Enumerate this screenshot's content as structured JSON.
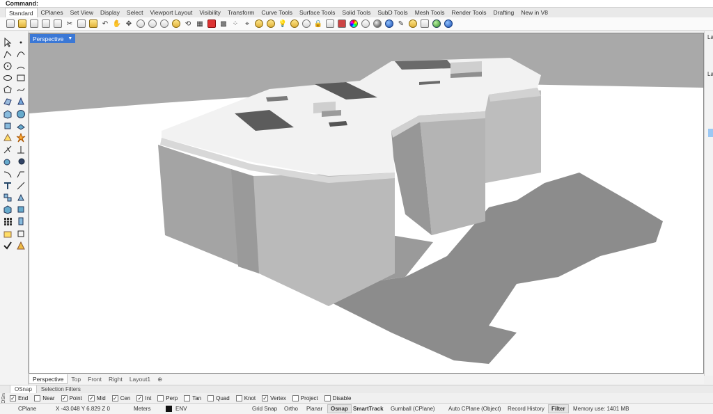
{
  "command": {
    "label": "Command:"
  },
  "tabs": [
    {
      "label": "Standard"
    },
    {
      "label": "CPlanes"
    },
    {
      "label": "Set View"
    },
    {
      "label": "Display"
    },
    {
      "label": "Select"
    },
    {
      "label": "Viewport Layout"
    },
    {
      "label": "Visibility"
    },
    {
      "label": "Transform"
    },
    {
      "label": "Curve Tools"
    },
    {
      "label": "Surface Tools"
    },
    {
      "label": "Solid Tools"
    },
    {
      "label": "SubD Tools"
    },
    {
      "label": "Mesh Tools"
    },
    {
      "label": "Render Tools"
    },
    {
      "label": "Drafting"
    },
    {
      "label": "New in V8"
    }
  ],
  "toolbar_icons": [
    "new-file-icon",
    "open-folder-icon",
    "save-icon",
    "print-icon",
    "import-icon",
    "cut-icon",
    "copy-icon",
    "paste-icon",
    "undo-icon",
    "pan-hand-icon",
    "move-view-icon",
    "zoom-icon",
    "zoom-window-icon",
    "zoom-extents-icon",
    "zoom-selected-icon",
    "rotate-view-icon",
    "viewport-layout-icon",
    "car-icon",
    "grid-icon",
    "select-points-icon",
    "wire-icon",
    "curve-icon",
    "lightbulb-icon",
    "drop-icon",
    "light-on-icon",
    "light-off-icon",
    "lock-icon",
    "unlock-icon",
    "tool-icon",
    "color-wheel-icon",
    "material-sphere-icon",
    "render-sphere-icon",
    "blue-sphere-icon",
    "wand-icon",
    "gears-icon",
    "print-render-icon",
    "green-sphere-icon",
    "help-icon"
  ],
  "viewport": {
    "label": "Perspective"
  },
  "view_tabs": [
    {
      "label": "Perspective"
    },
    {
      "label": "Top"
    },
    {
      "label": "Front"
    },
    {
      "label": "Right"
    },
    {
      "label": "Layout1"
    }
  ],
  "osnap_tabs": [
    {
      "label": "OSnap"
    },
    {
      "label": "Selection Filters"
    }
  ],
  "osnap_side_label": "OSnap",
  "osnap_items": [
    {
      "label": "End",
      "checked": true
    },
    {
      "label": "Near",
      "checked": false
    },
    {
      "label": "Point",
      "checked": true
    },
    {
      "label": "Mid",
      "checked": true
    },
    {
      "label": "Cen",
      "checked": true
    },
    {
      "label": "Int",
      "checked": true
    },
    {
      "label": "Perp",
      "checked": false
    },
    {
      "label": "Tan",
      "checked": false
    },
    {
      "label": "Quad",
      "checked": false
    },
    {
      "label": "Knot",
      "checked": false
    },
    {
      "label": "Vertex",
      "checked": true
    },
    {
      "label": "Project",
      "checked": false
    },
    {
      "label": "Disable",
      "checked": false
    }
  ],
  "status": {
    "cplane": "CPlane",
    "coords": "X -43.048  Y 6.829  Z 0",
    "units": "Meters",
    "layer": "ENV",
    "grid_snap": "Grid Snap",
    "ortho": "Ortho",
    "planar": "Planar",
    "osnap": "Osnap",
    "smarttrack": "SmartTrack",
    "gumball": "Gumball (CPlane)",
    "auto_cplane": "Auto CPlane (Object)",
    "record_history": "Record History",
    "filter": "Filter",
    "memory": "Memory use: 1401 MB"
  },
  "right_panel": {
    "tab1": "Lay",
    "tab2": "La"
  },
  "colors": {
    "viewport_bg": "#a9a9a9",
    "ground": "#ffffff",
    "shadow": "#8c8c8c",
    "accent": "#3b78d6"
  }
}
